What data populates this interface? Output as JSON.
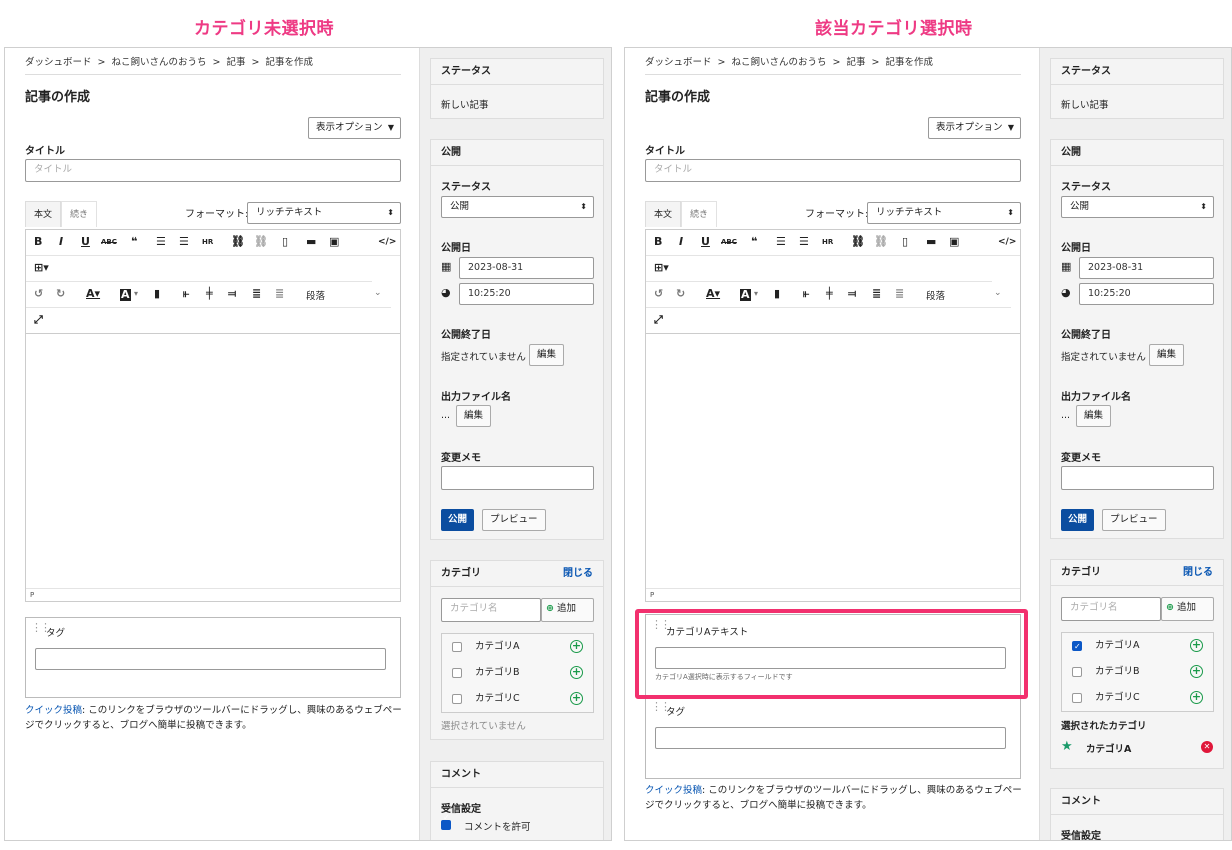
{
  "headings": {
    "left": "カテゴリ未選択時",
    "right": "該当カテゴリ選択時"
  },
  "breadcrumb": [
    "ダッシュボード",
    "ねこ飼いさんのおうち",
    "記事",
    "記事を作成"
  ],
  "breadcrumb_sep": ">",
  "page_title": "記事の作成",
  "display_options": "表示オプション",
  "title_label": "タイトル",
  "title_placeholder": "タイトル",
  "tabs": {
    "body": "本文",
    "more": "続き"
  },
  "format_label": "フォーマット:",
  "format_value": "リッチテキスト",
  "editor": {
    "paragraph": "段落",
    "statusbar": "P"
  },
  "custom_field": {
    "label": "カテゴリAテキスト",
    "note": "カテゴリA選択時に表示するフィールドです"
  },
  "tag_label": "タグ",
  "quick_post": {
    "link": "クイック投稿",
    "text": ": このリンクをブラウザのツールバーにドラッグし、興味のあるウェブページでクリックすると、ブログへ簡単に投稿できます。"
  },
  "sidebar": {
    "status_title": "ステータス",
    "status_value": "新しい記事",
    "publish_title": "公開",
    "status_label": "ステータス",
    "status_select": "公開",
    "publish_date_label": "公開日",
    "date": "2023-08-31",
    "time": "10:25:20",
    "end_date_label": "公開終了日",
    "end_date_value": "指定されていません",
    "edit": "編集",
    "output_label": "出力ファイル名",
    "output_value": "...",
    "memo_label": "変更メモ",
    "publish_button": "公開",
    "preview_button": "プレビュー",
    "category_title": "カテゴリ",
    "close": "閉じる",
    "category_placeholder": "カテゴリ名",
    "add": "追加",
    "categories": [
      "カテゴリA",
      "カテゴリB",
      "カテゴリC"
    ],
    "none_selected": "選択されていません",
    "selected_label": "選択されたカテゴリ",
    "selected_value": "カテゴリA",
    "comment_title": "コメント",
    "receive_label": "受信設定",
    "allow_comments": "コメントを許可"
  },
  "colors": {
    "heading": "#ee3a84",
    "highlight": "#f2306e",
    "primary": "#0b4da0",
    "link": "#0a57b3"
  }
}
